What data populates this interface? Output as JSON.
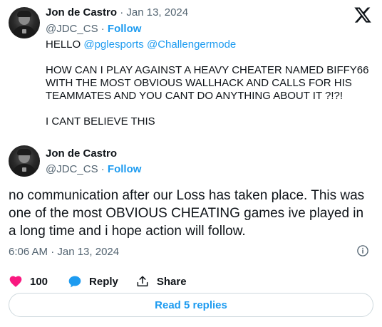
{
  "tweet1": {
    "name": "Jon de Castro",
    "date_sep": "·",
    "date": "Jan 13, 2024",
    "handle": "@JDC_CS",
    "handle_sep": "·",
    "follow": "Follow",
    "line1_prefix": "HELLO ",
    "mention1": "@pglesports",
    "mention2": "@Challengermode",
    "para2": "HOW CAN I PLAY AGAINST A HEAVY CHEATER NAMED BIFFY66 WITH THE MOST OBVIOUS WALLHACK AND CALLS FOR HIS TEAMMATES AND YOU CANT DO ANYTHING ABOUT IT ?!?!",
    "para3": "I CANT BELIEVE THIS"
  },
  "tweet2": {
    "name": "Jon de Castro",
    "handle": "@JDC_CS",
    "handle_sep": "·",
    "follow": "Follow",
    "text": "no communication after our Loss has taken place. This was one of the most OBVIOUS CHEATING games ive played in a long time and i hope action will follow.",
    "timestamp": "6:06 AM · Jan 13, 2024"
  },
  "actions": {
    "likes": "100",
    "reply": "Reply",
    "share": "Share"
  },
  "read_replies": "Read 5 replies",
  "colors": {
    "accent": "#1d9bf0",
    "like": "#f91880",
    "text": "#0f1419",
    "muted": "#536471"
  }
}
